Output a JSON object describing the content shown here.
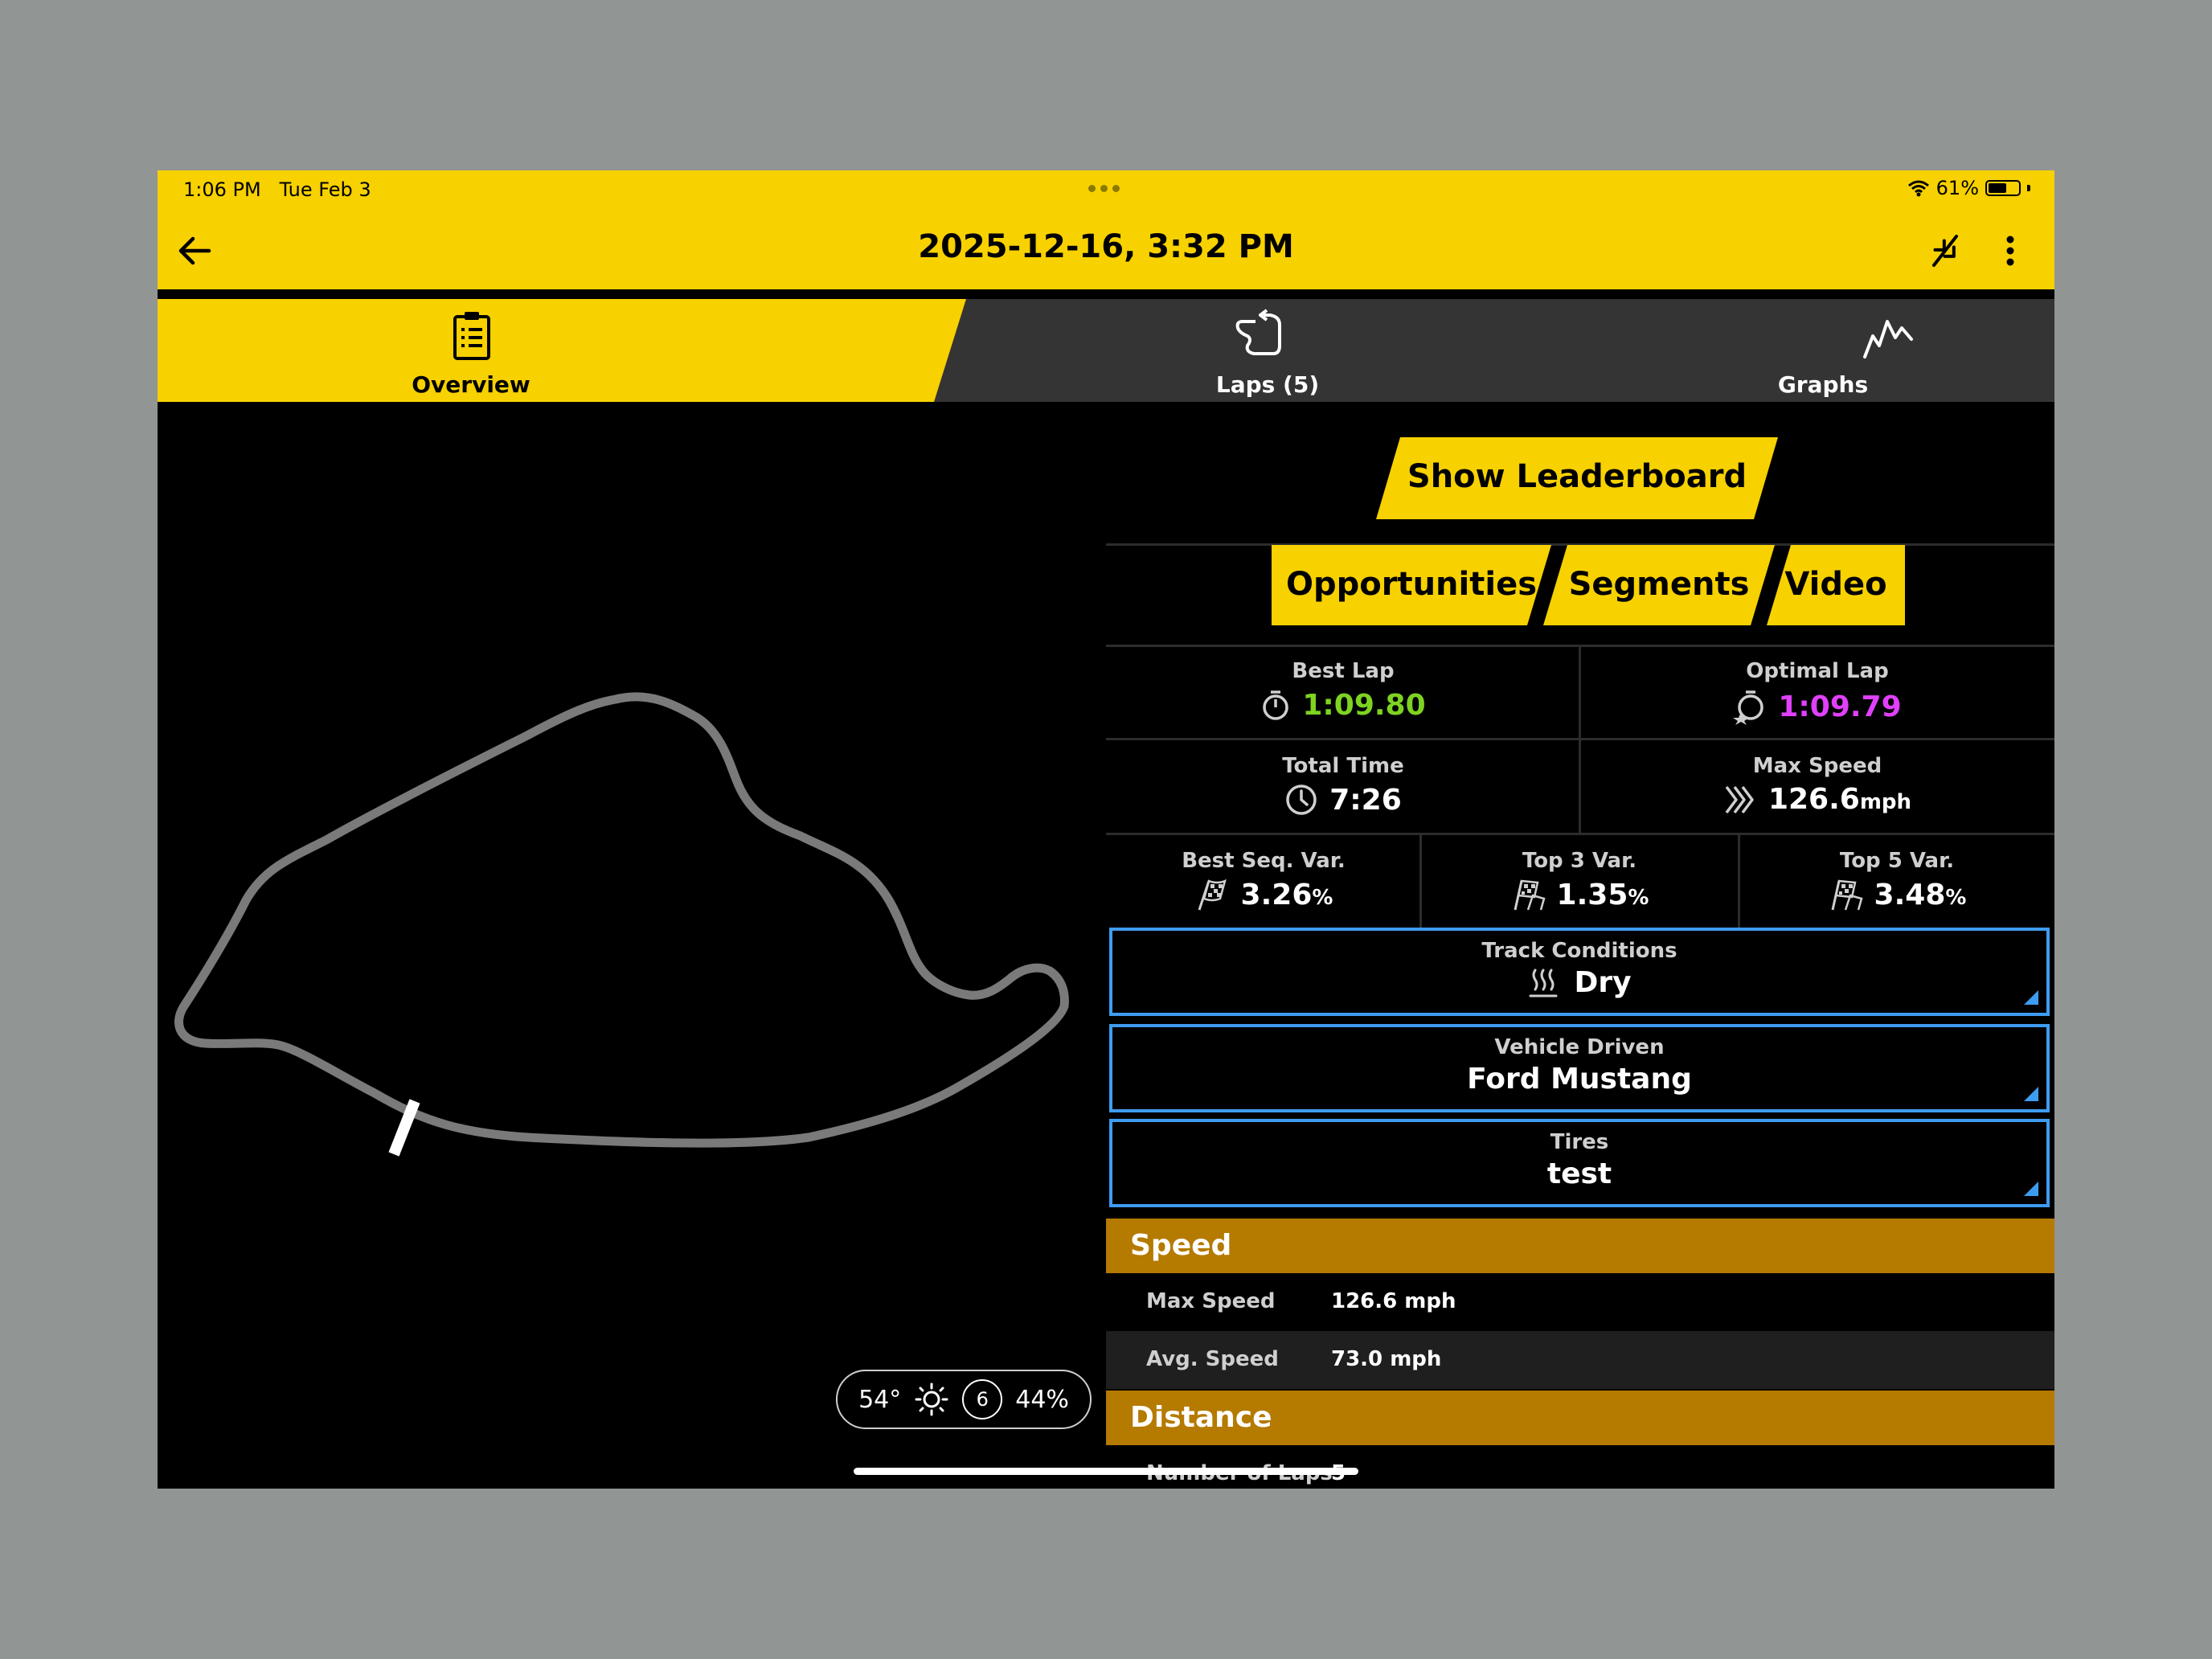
{
  "status_bar": {
    "time": "1:06 PM",
    "date": "Tue Feb 3",
    "battery": "61%",
    "battery_level": 0.61
  },
  "header": {
    "title": "2025-12-16, 3:32 PM"
  },
  "tabs": [
    {
      "label": "Overview"
    },
    {
      "label": "Laps (5)"
    },
    {
      "label": "Graphs"
    }
  ],
  "weather": {
    "temp": "54°",
    "wind": "6",
    "humidity": "44%"
  },
  "actions": {
    "leaderboard": "Show Leaderboard",
    "opportunities": "Opportunities",
    "segments": "Segments",
    "video": "Video"
  },
  "stats": {
    "best_lap": {
      "label": "Best Lap",
      "value": "1:09.80",
      "color": "#7ed321"
    },
    "optimal_lap": {
      "label": "Optimal Lap",
      "value": "1:09.79",
      "color": "#e040fb"
    },
    "total_time": {
      "label": "Total Time",
      "value": "7:26"
    },
    "max_speed": {
      "label": "Max Speed",
      "value": "126.6",
      "unit": "mph"
    },
    "best_seq_var": {
      "label": "Best Seq. Var.",
      "value": "3.26",
      "unit": "%"
    },
    "top3_var": {
      "label": "Top 3 Var.",
      "value": "1.35",
      "unit": "%"
    },
    "top5_var": {
      "label": "Top 5 Var.",
      "value": "3.48",
      "unit": "%"
    }
  },
  "selectors": {
    "track_conditions": {
      "label": "Track Conditions",
      "value": "Dry"
    },
    "vehicle": {
      "label": "Vehicle Driven",
      "value": "Ford Mustang"
    },
    "tires": {
      "label": "Tires",
      "value": "test"
    }
  },
  "speed_section": {
    "title": "Speed",
    "rows": [
      {
        "key": "Max Speed",
        "value": "126.6 mph"
      },
      {
        "key": "Avg. Speed",
        "value": "73.0 mph"
      }
    ]
  },
  "distance_section": {
    "title": "Distance",
    "rows": [
      {
        "key": "Number of Laps",
        "value": "5"
      }
    ]
  },
  "colors": {
    "accent": "#f7d100",
    "section": "#b57a00",
    "selector_border": "#3e9cf0"
  }
}
